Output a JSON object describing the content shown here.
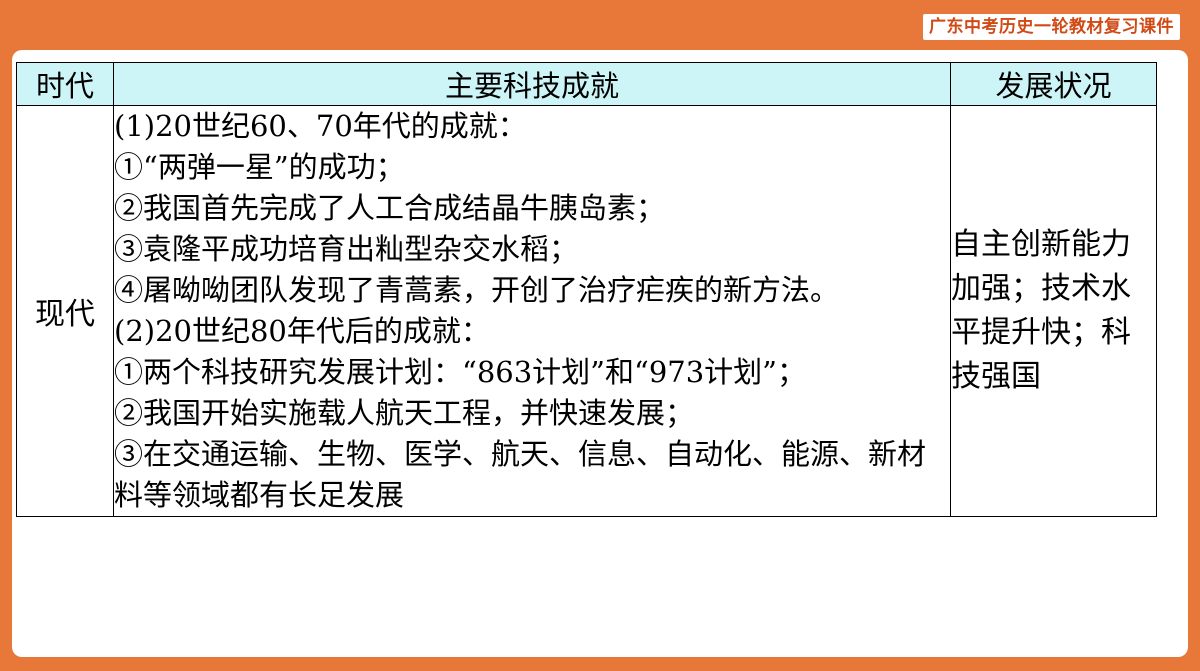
{
  "header": {
    "course_title": "广东中考历史一轮教材复习课件"
  },
  "table": {
    "headers": {
      "era": "时代",
      "achievements": "主要科技成就",
      "status": "发展状况"
    },
    "row": {
      "era": "现代",
      "achievements": [
        "(1)20世纪60、70年代的成就：",
        "①“两弹一星”的成功；",
        "②我国首先完成了人工合成结晶牛胰岛素；",
        "③袁隆平成功培育出籼型杂交水稻；",
        "④屠呦呦团队发现了青蒿素，开创了治疗疟疾的新方法。",
        "(2)20世纪80年代后的成就：",
        "①两个科技研究发展计划：“863计划”和“973计划”；",
        "②我国开始实施载人航天工程，并快速发展；",
        "③在交通运输、生物、医学、航天、信息、自动化、能源、新材料等领域都有长足发展"
      ],
      "status": "自主创新能力加强；技术水平提升快；科技强国"
    }
  }
}
